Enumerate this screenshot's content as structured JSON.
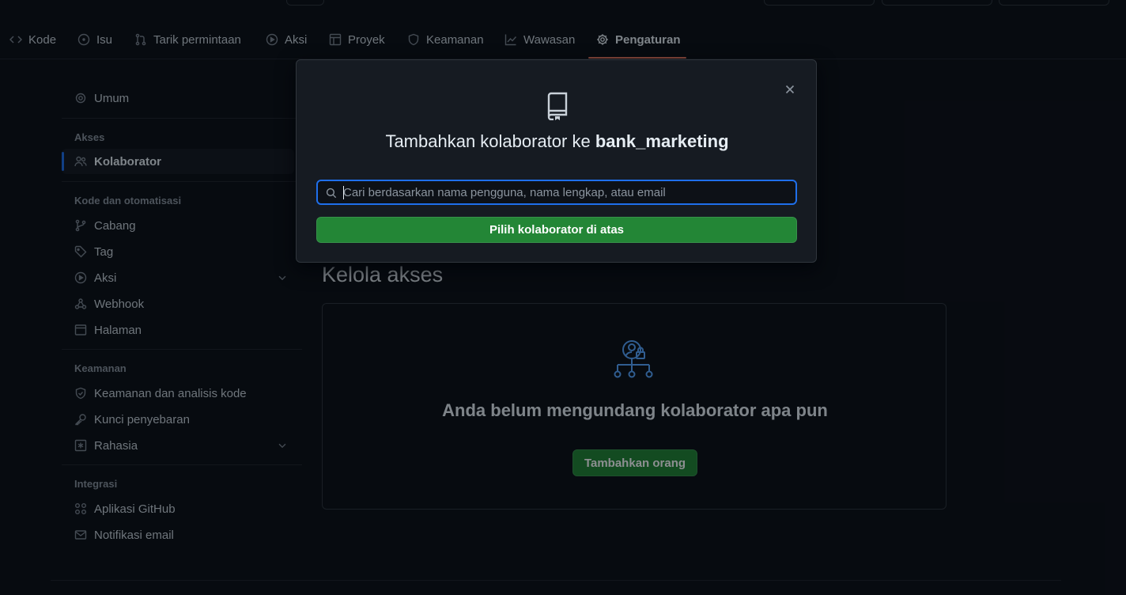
{
  "nav": {
    "items": [
      {
        "label": "Kode",
        "icon": "code-icon"
      },
      {
        "label": "Isu",
        "icon": "issue-icon"
      },
      {
        "label": "Tarik permintaan",
        "icon": "pull-request-icon"
      },
      {
        "label": "Aksi",
        "icon": "play-icon"
      },
      {
        "label": "Proyek",
        "icon": "table-icon"
      },
      {
        "label": "Keamanan",
        "icon": "shield-icon"
      },
      {
        "label": "Wawasan",
        "icon": "graph-icon"
      },
      {
        "label": "Pengaturan",
        "icon": "gear-icon",
        "active": true
      }
    ]
  },
  "sidebar": {
    "general": "Umum",
    "access_heading": "Akses",
    "collaborators": "Kolaborator",
    "code_heading": "Kode dan otomatisasi",
    "branches": "Cabang",
    "tags": "Tag",
    "actions": "Aksi",
    "webhooks": "Webhook",
    "pages": "Halaman",
    "security_heading": "Keamanan",
    "code_security": "Keamanan dan analisis kode",
    "deploy_keys": "Kunci penyebaran",
    "secrets": "Rahasia",
    "integrations_heading": "Integrasi",
    "github_apps": "Aplikasi GitHub",
    "email_notifications": "Notifikasi email"
  },
  "main": {
    "title": "Kelola akses",
    "empty_text": "Anda belum mengundang kolaborator apa pun",
    "add_people": "Tambahkan orang"
  },
  "modal": {
    "title_prefix": "Tambahkan kolaborator ke ",
    "repo_name": "bank_marketing",
    "search_placeholder": "Cari berdasarkan nama pengguna, nama lengkap, atau email",
    "search_value": "",
    "select_button": "Pilih kolaborator di atas"
  },
  "colors": {
    "accent_blue": "#1f6feb",
    "button_green": "#238636",
    "active_tab_underline": "#f78166",
    "background": "#0d1117"
  }
}
